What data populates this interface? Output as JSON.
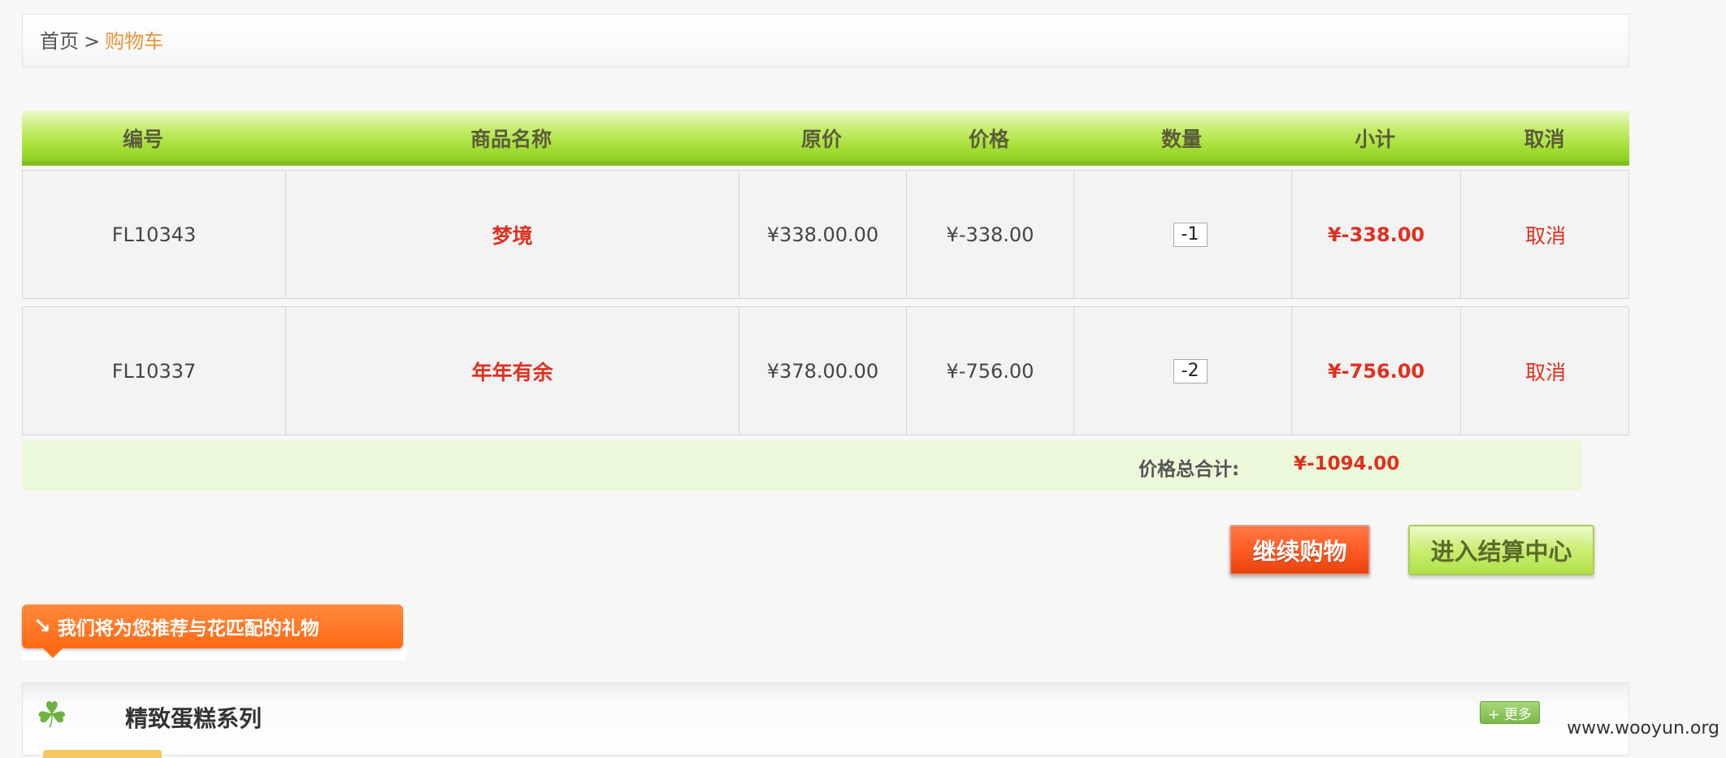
{
  "breadcrumb": {
    "home": "首页",
    "separator": ">",
    "current": "购物车"
  },
  "table": {
    "headers": [
      "编号",
      "商品名称",
      "原价",
      "价格",
      "数量",
      "小计",
      "取消"
    ],
    "rows": [
      {
        "id": "FL10343",
        "name": "梦境",
        "original_price": "¥338.00.00",
        "price": "¥-338.00",
        "quantity": "-1",
        "subtotal": "¥-338.00",
        "cancel": "取消"
      },
      {
        "id": "FL10337",
        "name": "年年有余",
        "original_price": "¥378.00.00",
        "price": "¥-756.00",
        "quantity": "-2",
        "subtotal": "¥-756.00",
        "cancel": "取消"
      }
    ]
  },
  "total": {
    "label": "价格总合计:",
    "value": "¥-1094.00"
  },
  "buttons": {
    "continue": "继续购物",
    "checkout": "进入结算中心"
  },
  "recommend": {
    "text": "我们将为您推荐与花匹配的礼物"
  },
  "section": {
    "title": "精致蛋糕系列",
    "more": "+ 更多"
  },
  "watermark": "www.wooyun.org",
  "colors": {
    "accent_red": "#e03020",
    "header_green": "#a9e03a",
    "orange": "#ff6a16",
    "breadcrumb_current": "#e8943a"
  },
  "icons": {
    "section_icon": "clover-icon",
    "recommend_icon": "arrow-down-right-icon"
  }
}
